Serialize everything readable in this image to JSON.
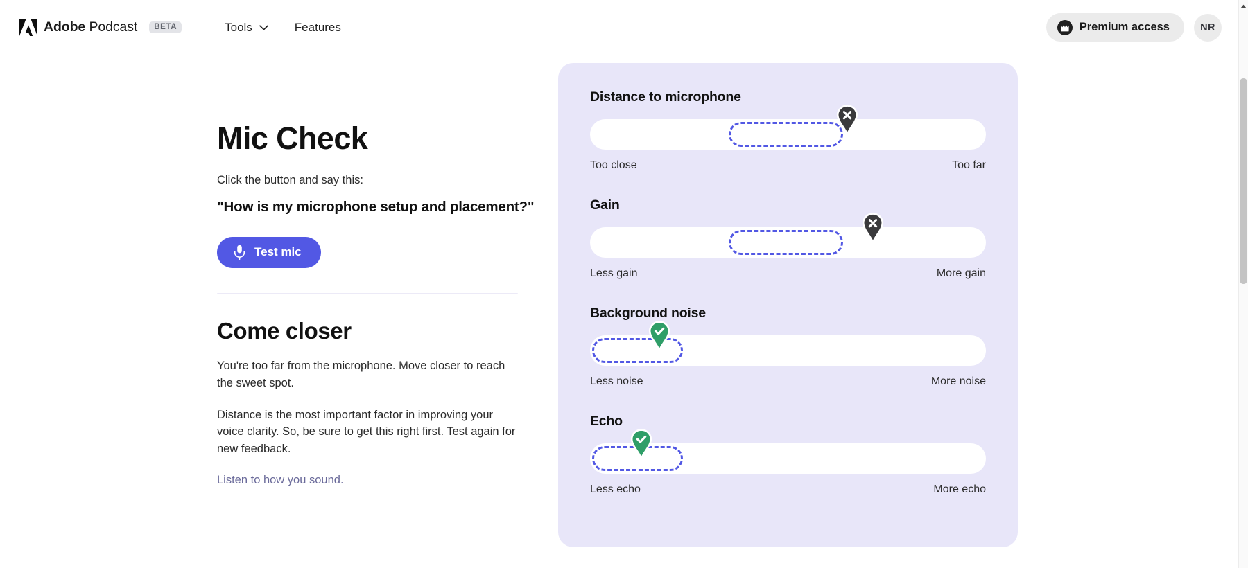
{
  "header": {
    "logo_icon": "adobe-logo-icon",
    "brand_bold": "Adobe",
    "brand_light": " Podcast",
    "beta_label": "BETA",
    "nav": [
      {
        "label": "Tools",
        "has_chevron": true
      },
      {
        "label": "Features",
        "has_chevron": false
      }
    ],
    "premium_label": "Premium access",
    "premium_icon": "crown-badge-icon",
    "avatar_initials": "NR",
    "premium_bg": "#ebebeb"
  },
  "left": {
    "title": "Mic Check",
    "lead": "Click the button and say this:",
    "quote": "\"How is my microphone setup and placement?\"",
    "test_button_label": "Test mic",
    "test_button_icon": "microphone-icon",
    "test_button_color": "#5258e4",
    "result_title": "Come closer",
    "result_paragraph_1": "You're too far from the microphone. Move closer to reach the sweet spot.",
    "result_paragraph_2": "Distance is the most important factor in improving your voice clarity. So, be sure to get this right first. Test again for new feedback.",
    "listen_link": "Listen to how you sound.",
    "link_color": "#6a6a9a"
  },
  "panel": {
    "background": "#e8e6f9",
    "accent": "#5258e4",
    "pass_color": "#2f9e68",
    "fail_color": "#3a3a3c",
    "meters": [
      {
        "title": "Distance to microphone",
        "left_label": "Too close",
        "right_label": "Too far",
        "status": "fail",
        "status_icon": "close-x-icon",
        "pin_position_pct": 65,
        "zone_start_pct": 35,
        "zone_end_pct": 64
      },
      {
        "title": "Gain",
        "left_label": "Less gain",
        "right_label": "More gain",
        "status": "fail",
        "status_icon": "close-x-icon",
        "pin_position_pct": 71.5,
        "zone_start_pct": 35,
        "zone_end_pct": 64
      },
      {
        "title": "Background noise",
        "left_label": "Less noise",
        "right_label": "More noise",
        "status": "pass",
        "status_icon": "check-icon",
        "pin_position_pct": 17.5,
        "zone_start_pct": 0.5,
        "zone_end_pct": 23.5
      },
      {
        "title": "Echo",
        "left_label": "Less echo",
        "right_label": "More echo",
        "status": "pass",
        "status_icon": "check-icon",
        "pin_position_pct": 13,
        "zone_start_pct": 0.5,
        "zone_end_pct": 23.5
      }
    ]
  },
  "scrollbar": {
    "up_arrow_icon": "scroll-up-arrow-icon",
    "thumb_color": "#c4c4c4"
  }
}
